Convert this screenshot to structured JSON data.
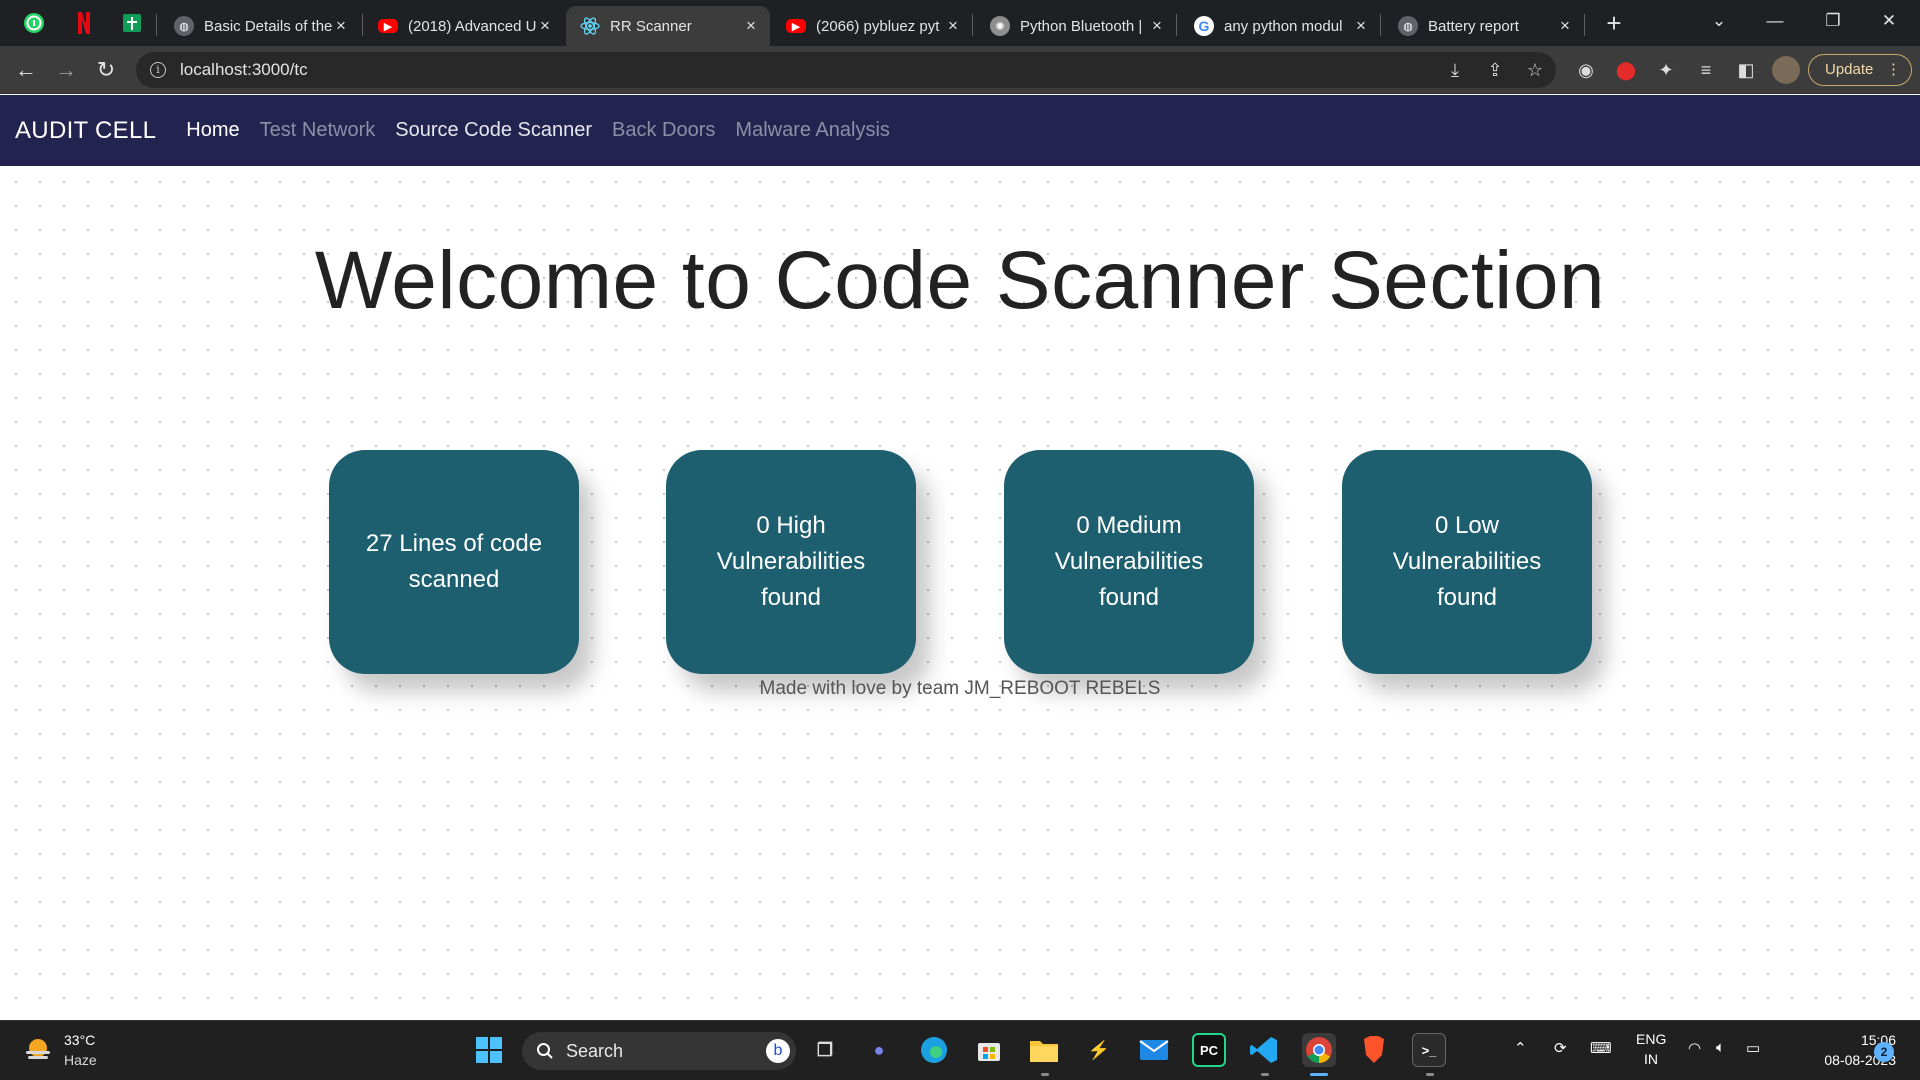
{
  "browser": {
    "pinned_tabs": [
      {
        "name": "whatsapp-icon",
        "color": "#25d366"
      },
      {
        "name": "netflix-icon",
        "color": "#e50914"
      },
      {
        "name": "sheets-icon",
        "color": "#0f9d58"
      }
    ],
    "tabs": [
      {
        "title": "Basic Details of the",
        "favicon": "globe-icon",
        "color": "#9aa0a6"
      },
      {
        "title": "(2018) Advanced U",
        "favicon": "youtube-icon",
        "color": "#ff0000"
      },
      {
        "title": "RR Scanner",
        "favicon": "react-icon",
        "color": "#61dafb",
        "active": true
      },
      {
        "title": "(2066) pybluez pyt",
        "favicon": "youtube-icon",
        "color": "#ff0000"
      },
      {
        "title": "Python Bluetooth |",
        "favicon": "chatgpt-icon",
        "color": "#9aa0a6"
      },
      {
        "title": "any python modul",
        "favicon": "google-icon",
        "color": "#4285f4"
      },
      {
        "title": "Battery report",
        "favicon": "globe-icon",
        "color": "#9aa0a6"
      }
    ],
    "close_glyph": "×",
    "new_tab_glyph": "+",
    "url": "localhost:3000/tc",
    "update_label": "Update"
  },
  "app": {
    "brand": "AUDIT CELL",
    "nav": [
      {
        "label": "Home"
      },
      {
        "label": "Test Network"
      },
      {
        "label": "Source Code Scanner"
      },
      {
        "label": "Back Doors"
      },
      {
        "label": "Malware Analysis"
      }
    ],
    "welcome": "Welcome to Code Scanner Section",
    "cards": [
      {
        "text": "27 Lines of code scanned"
      },
      {
        "text": "0 High Vulnerabilities found"
      },
      {
        "text": "0 Medium Vulnerabilities found"
      },
      {
        "text": "0 Low Vulnerabilities found"
      }
    ],
    "footer": "Made with love by team JM_REBOOT REBELS",
    "card_color": "#1d5f6e",
    "nav_color": "#232350"
  },
  "taskbar": {
    "weather": {
      "temp": "33°C",
      "condition": "Haze"
    },
    "search_label": "Search",
    "tray": {
      "lang": "ENG",
      "region": "IN"
    },
    "clock": {
      "time": "15:06",
      "date": "08-08-2023"
    },
    "notifications": "2"
  }
}
